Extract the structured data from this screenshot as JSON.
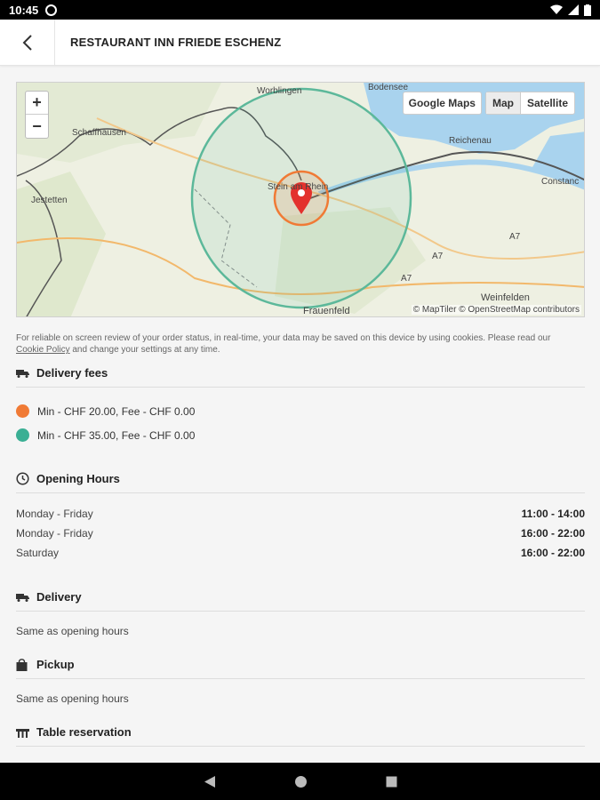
{
  "status": {
    "time": "10:45"
  },
  "header": {
    "title": "RESTAURANT INN FRIEDE ESCHENZ"
  },
  "map": {
    "zoom_in": "+",
    "zoom_out": "−",
    "google_maps": "Google Maps",
    "map_type": "Map",
    "satellite": "Satellite",
    "attribution": "© MapTiler © OpenStreetMap contributors",
    "places": {
      "worblingen": "Worblingen",
      "bodensee": "Bodensee",
      "schaffhausen": "Schaffhausen",
      "reichenau": "Reichenau",
      "jestetten": "Jestetten",
      "constance": "Constanc",
      "stein": "Stein am Rhein",
      "weinfelden": "Weinfelden",
      "frauenfeld": "Frauenfeld",
      "a7_1": "A7",
      "a7_2": "A7",
      "a7_3": "A7"
    }
  },
  "cookie": {
    "text": "For reliable on screen review of your order status, in real-time, your data may be saved on this device by using cookies. Please read our",
    "link": "Cookie Policy",
    "text2": "and change your settings at any time."
  },
  "delivery_fees": {
    "title": "Delivery fees",
    "items": [
      {
        "label": "Min - CHF 20.00, Fee - CHF 0.00",
        "color": "#f07a35"
      },
      {
        "label": "Min - CHF 35.00, Fee - CHF 0.00",
        "color": "#3aaf94"
      }
    ]
  },
  "opening_hours": {
    "title": "Opening Hours",
    "rows": [
      {
        "day": "Monday - Friday",
        "time": "11:00 - 14:00"
      },
      {
        "day": "Monday - Friday",
        "time": "16:00 - 22:00"
      },
      {
        "day": "Saturday",
        "time": "16:00 - 22:00"
      }
    ]
  },
  "delivery": {
    "title": "Delivery",
    "text": "Same as opening hours"
  },
  "pickup": {
    "title": "Pickup",
    "text": "Same as opening hours"
  },
  "table_reservation": {
    "title": "Table reservation"
  }
}
